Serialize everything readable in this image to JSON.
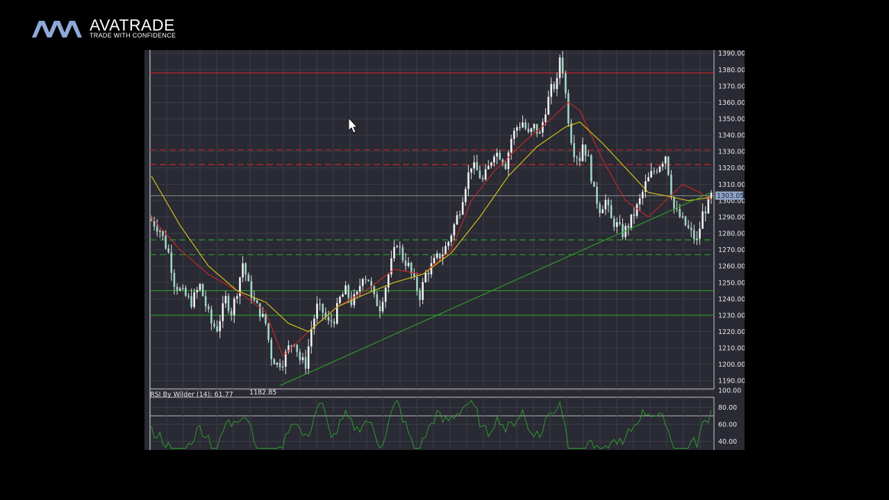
{
  "brand": {
    "wordmark": "AVATRADE",
    "tagline": "TRADE WITH CONFIDENCE",
    "logo_color": "#8fa9d6"
  },
  "chart_data": {
    "type": "candlestick",
    "price_panel": {
      "ylim": [
        1185,
        1392
      ],
      "y_ticks": [
        1190,
        1200,
        1210,
        1220,
        1230,
        1240,
        1250,
        1260,
        1270,
        1280,
        1290,
        1300,
        1310,
        1320,
        1330,
        1340,
        1350,
        1360,
        1370,
        1380,
        1390
      ],
      "y_tick_labels": [
        "1190.00",
        "1200.00",
        "1210.00",
        "1220.00",
        "1230.00",
        "1240.00",
        "1250.00",
        "1260.00",
        "1270.00",
        "1280.00",
        "1290.00",
        "1300.00",
        "1310.00",
        "1320.00",
        "1330.00",
        "1340.00",
        "1350.00",
        "1360.00",
        "1370.00",
        "1380.00",
        "1390.00"
      ],
      "last_price": 1303.05,
      "last_price_label": "1303.05",
      "low_annotation": {
        "value": 1182.85,
        "label": "1182.85",
        "bar_index": 45
      },
      "bar_count": 160,
      "close_path": [
        [
          0,
          1288
        ],
        [
          3,
          1282
        ],
        [
          6,
          1268
        ],
        [
          8,
          1250
        ],
        [
          10,
          1245
        ],
        [
          14,
          1238
        ],
        [
          17,
          1248
        ],
        [
          19,
          1236
        ],
        [
          21,
          1225
        ],
        [
          23,
          1222
        ],
        [
          26,
          1240
        ],
        [
          28,
          1232
        ],
        [
          30,
          1245
        ],
        [
          32,
          1262
        ],
        [
          34,
          1248
        ],
        [
          36,
          1238
        ],
        [
          38,
          1232
        ],
        [
          40,
          1225
        ],
        [
          42,
          1205
        ],
        [
          44,
          1200
        ],
        [
          46,
          1202
        ],
        [
          48,
          1210
        ],
        [
          50,
          1215
        ],
        [
          52,
          1203
        ],
        [
          54,
          1200
        ],
        [
          56,
          1222
        ],
        [
          58,
          1235
        ],
        [
          60,
          1232
        ],
        [
          62,
          1225
        ],
        [
          64,
          1228
        ],
        [
          66,
          1240
        ],
        [
          68,
          1245
        ],
        [
          70,
          1238
        ],
        [
          72,
          1242
        ],
        [
          74,
          1255
        ],
        [
          76,
          1252
        ],
        [
          78,
          1240
        ],
        [
          80,
          1235
        ],
        [
          82,
          1248
        ],
        [
          84,
          1262
        ],
        [
          86,
          1275
        ],
        [
          88,
          1265
        ],
        [
          90,
          1260
        ],
        [
          92,
          1250
        ],
        [
          94,
          1242
        ],
        [
          96,
          1255
        ],
        [
          98,
          1260
        ],
        [
          100,
          1265
        ],
        [
          102,
          1268
        ],
        [
          104,
          1275
        ],
        [
          106,
          1285
        ],
        [
          108,
          1295
        ],
        [
          110,
          1310
        ],
        [
          112,
          1322
        ],
        [
          114,
          1318
        ],
        [
          116,
          1312
        ],
        [
          118,
          1320
        ],
        [
          120,
          1330
        ],
        [
          122,
          1328
        ],
        [
          124,
          1322
        ],
        [
          126,
          1338
        ],
        [
          128,
          1345
        ],
        [
          130,
          1348
        ],
        [
          132,
          1340
        ],
        [
          134,
          1345
        ],
        [
          136,
          1340
        ],
        [
          138,
          1356
        ],
        [
          140,
          1368
        ],
        [
          142,
          1372
        ],
        [
          143,
          1388
        ],
        [
          144,
          1380
        ],
        [
          145,
          1365
        ],
        [
          146,
          1350
        ],
        [
          147,
          1338
        ],
        [
          148,
          1330
        ],
        [
          150,
          1326
        ],
        [
          151,
          1335
        ],
        [
          153,
          1325
        ],
        [
          155,
          1305
        ],
        [
          157,
          1295
        ],
        [
          159,
          1300
        ],
        [
          161,
          1288
        ],
        [
          163,
          1285
        ],
        [
          165,
          1280
        ],
        [
          167,
          1285
        ],
        [
          169,
          1292
        ],
        [
          171,
          1300
        ],
        [
          173,
          1310
        ],
        [
          175,
          1316
        ],
        [
          177,
          1320
        ],
        [
          179,
          1325
        ],
        [
          180,
          1328
        ],
        [
          181,
          1318
        ],
        [
          182,
          1305
        ],
        [
          183,
          1295
        ],
        [
          185,
          1290
        ],
        [
          187,
          1285
        ],
        [
          189,
          1280
        ],
        [
          191,
          1275
        ],
        [
          193,
          1292
        ],
        [
          195,
          1298
        ],
        [
          196,
          1303
        ]
      ],
      "horizontal_levels": [
        {
          "value": 1378,
          "style": "solid",
          "color": "#c62828"
        },
        {
          "value": 1331,
          "style": "dashed",
          "color": "#c62828"
        },
        {
          "value": 1322,
          "style": "dashed",
          "color": "#c62828"
        },
        {
          "value": 1303,
          "style": "solid",
          "color": "#8a8a8a"
        },
        {
          "value": 1276,
          "style": "dashed",
          "color": "#2e9e2e"
        },
        {
          "value": 1267,
          "style": "dashed",
          "color": "#2e9e2e"
        },
        {
          "value": 1245,
          "style": "solid",
          "color": "#2e9e2e"
        },
        {
          "value": 1230,
          "style": "solid",
          "color": "#2e9e2e"
        }
      ],
      "trendline": {
        "from": [
          45,
          1187
        ],
        "to": [
          196,
          1305
        ],
        "color": "#2e9e2e"
      },
      "moving_averages": [
        {
          "color": "#c62828",
          "points": [
            [
              0,
              1290
            ],
            [
              10,
              1270
            ],
            [
              20,
              1255
            ],
            [
              30,
              1245
            ],
            [
              40,
              1232
            ],
            [
              46,
              1205
            ],
            [
              55,
              1220
            ],
            [
              65,
              1235
            ],
            [
              75,
              1245
            ],
            [
              85,
              1258
            ],
            [
              95,
              1255
            ],
            [
              105,
              1270
            ],
            [
              112,
              1300
            ],
            [
              120,
              1318
            ],
            [
              130,
              1335
            ],
            [
              140,
              1350
            ],
            [
              146,
              1360
            ],
            [
              150,
              1355
            ],
            [
              158,
              1325
            ],
            [
              166,
              1300
            ],
            [
              174,
              1290
            ],
            [
              180,
              1300
            ],
            [
              186,
              1310
            ],
            [
              192,
              1305
            ],
            [
              196,
              1300
            ]
          ]
        },
        {
          "color": "#d4c21a",
          "points": [
            [
              0,
              1315
            ],
            [
              10,
              1285
            ],
            [
              20,
              1260
            ],
            [
              30,
              1245
            ],
            [
              40,
              1238
            ],
            [
              48,
              1225
            ],
            [
              55,
              1220
            ],
            [
              65,
              1235
            ],
            [
              75,
              1243
            ],
            [
              85,
              1250
            ],
            [
              95,
              1255
            ],
            [
              105,
              1268
            ],
            [
              115,
              1290
            ],
            [
              125,
              1315
            ],
            [
              135,
              1333
            ],
            [
              145,
              1345
            ],
            [
              150,
              1348
            ],
            [
              158,
              1335
            ],
            [
              166,
              1320
            ],
            [
              174,
              1305
            ],
            [
              180,
              1303
            ],
            [
              188,
              1300
            ],
            [
              196,
              1302
            ]
          ]
        }
      ]
    },
    "rsi_panel": {
      "title": "RSI By Wilder (14): 61.77",
      "ylim": [
        30,
        100
      ],
      "y_ticks": [
        40,
        60,
        80,
        100
      ],
      "y_tick_labels": [
        "40.00",
        "60.00",
        "80.00",
        "100.00"
      ],
      "reference_line": 70,
      "series_color": "#2e9e2e"
    },
    "colors": {
      "background": "#292a33",
      "grid": "#3d3e48",
      "candle": "#e8e8e8",
      "axis": "#d0d0d0"
    }
  }
}
